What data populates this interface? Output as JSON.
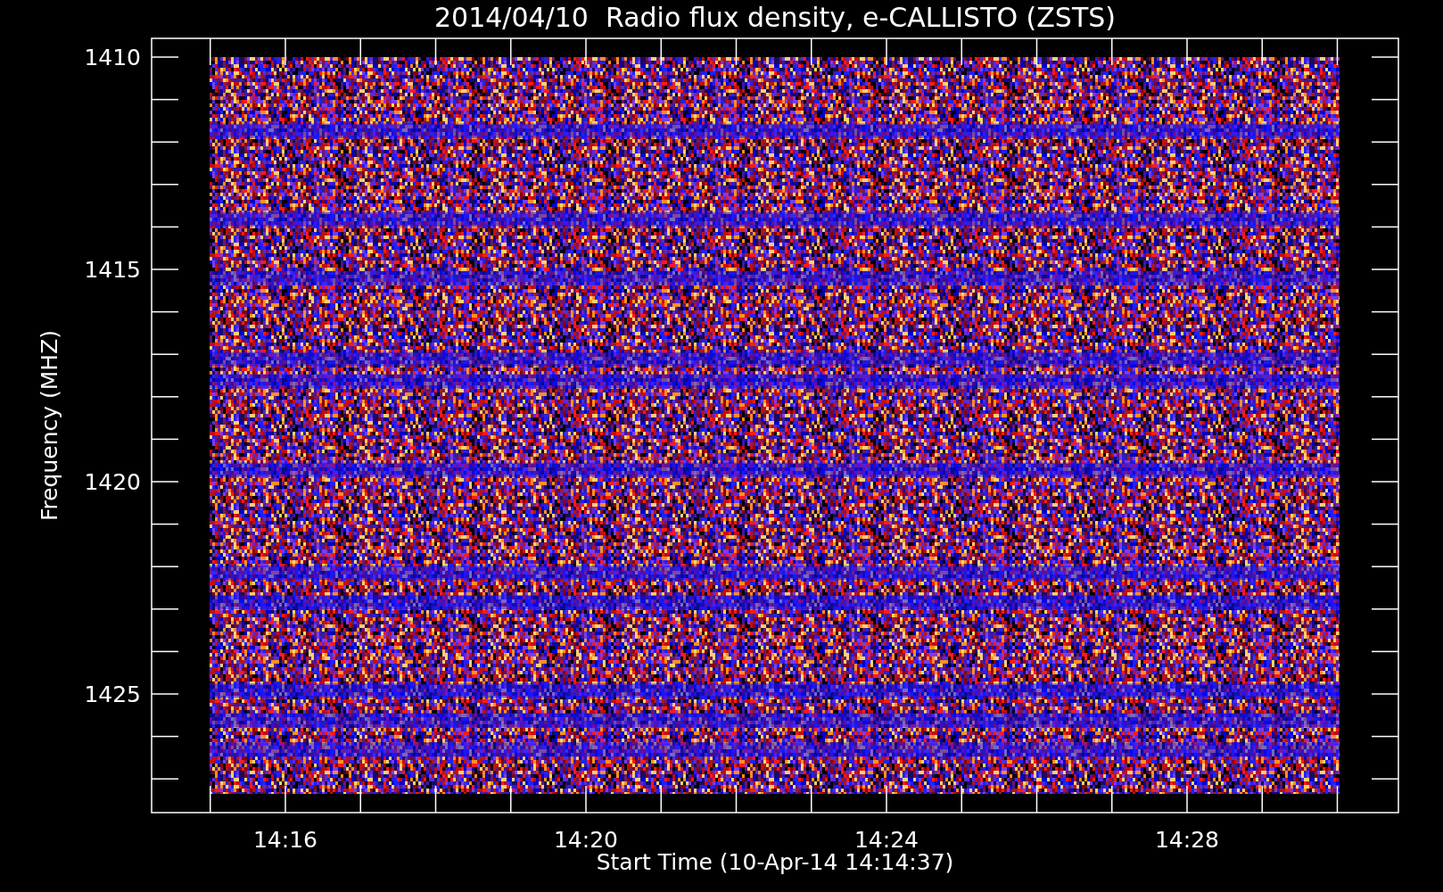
{
  "title": "2014/04/10  Radio flux density, e-CALLISTO (ZSTS)",
  "y_axis": {
    "label": "Frequency (MHZ)",
    "ticks": [
      "1410",
      "1415",
      "1420",
      "1425"
    ]
  },
  "x_axis": {
    "label": "Start Time (10-Apr-14 14:14:37)",
    "ticks": [
      "14:16",
      "14:20",
      "14:24",
      "14:28"
    ]
  }
}
